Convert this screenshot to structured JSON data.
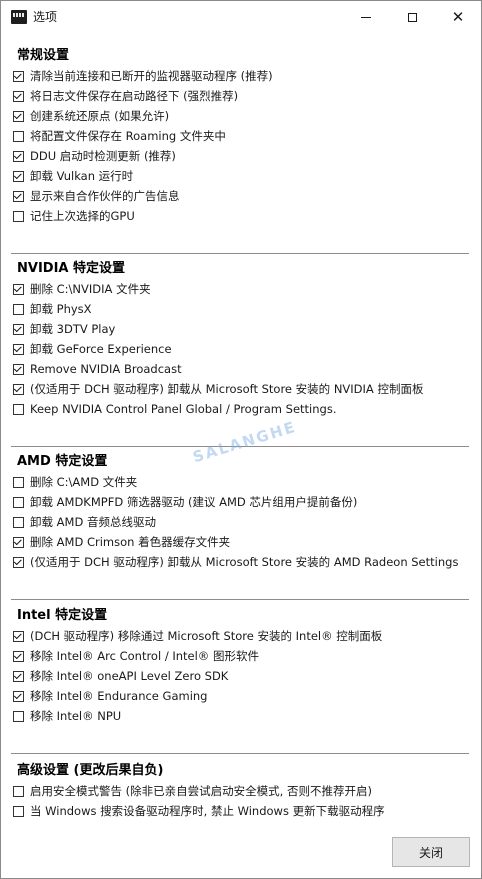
{
  "window": {
    "title": "选项",
    "min_label": "minimize",
    "max_label": "maximize",
    "close_label": "close"
  },
  "sections": [
    {
      "title": "常规设置",
      "options": [
        {
          "label": "清除当前连接和已断开的监视器驱动程序 (推荐)",
          "checked": true
        },
        {
          "label": "将日志文件保存在启动路径下 (强烈推荐)",
          "checked": true
        },
        {
          "label": "创建系统还原点 (如果允许)",
          "checked": true
        },
        {
          "label": "将配置文件保存在 Roaming 文件夹中",
          "checked": false
        },
        {
          "label": "DDU 启动时检测更新 (推荐)",
          "checked": true
        },
        {
          "label": "卸载 Vulkan 运行时",
          "checked": true
        },
        {
          "label": "显示来自合作伙伴的广告信息",
          "checked": true
        },
        {
          "label": "记住上次选择的GPU",
          "checked": false
        }
      ]
    },
    {
      "title": "NVIDIA 特定设置",
      "options": [
        {
          "label": "删除 C:\\NVIDIA 文件夹",
          "checked": true
        },
        {
          "label": "卸载 PhysX",
          "checked": false
        },
        {
          "label": "卸载 3DTV Play",
          "checked": true
        },
        {
          "label": "卸载 GeForce Experience",
          "checked": true
        },
        {
          "label": "Remove NVIDIA Broadcast",
          "checked": true
        },
        {
          "label": "(仅适用于 DCH 驱动程序) 卸载从 Microsoft Store 安装的 NVIDIA 控制面板",
          "checked": true
        },
        {
          "label": "Keep NVIDIA Control Panel Global / Program Settings.",
          "checked": false
        }
      ]
    },
    {
      "title": "AMD 特定设置",
      "options": [
        {
          "label": "删除 C:\\AMD 文件夹",
          "checked": false
        },
        {
          "label": "卸载 AMDKMPFD 筛选器驱动 (建议 AMD 芯片组用户提前备份)",
          "checked": false
        },
        {
          "label": "卸载 AMD 音频总线驱动",
          "checked": false
        },
        {
          "label": "删除 AMD Crimson 着色器缓存文件夹",
          "checked": true
        },
        {
          "label": "(仅适用于 DCH 驱动程序) 卸载从 Microsoft Store 安装的 AMD Radeon Settings",
          "checked": true
        }
      ]
    },
    {
      "title": "Intel 特定设置",
      "options": [
        {
          "label": "(DCH 驱动程序) 移除通过 Microsoft Store 安装的 Intel® 控制面板",
          "checked": true
        },
        {
          "label": "移除 Intel® Arc Control / Intel® 图形软件",
          "checked": true
        },
        {
          "label": "移除 Intel® oneAPI Level Zero SDK",
          "checked": true
        },
        {
          "label": "移除 Intel® Endurance Gaming",
          "checked": true
        },
        {
          "label": "移除 Intel® NPU",
          "checked": false
        }
      ]
    },
    {
      "title": "高级设置 (更改后果自负)",
      "options": [
        {
          "label": "启用安全模式警告 (除非已亲自尝试启动安全模式, 否则不推荐开启)",
          "checked": false
        },
        {
          "label": "当 Windows 搜索设备驱动程序时, 禁止 Windows 更新下载驱动程序",
          "checked": false
        }
      ]
    }
  ],
  "watermark": "SALANGHE",
  "footer": {
    "close_button_label": "关闭"
  }
}
